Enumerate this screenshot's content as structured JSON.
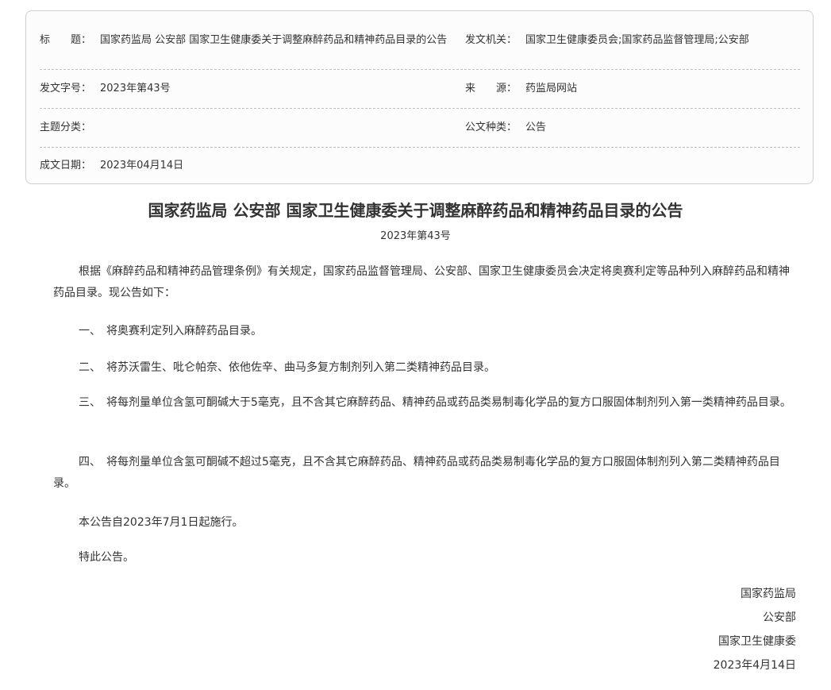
{
  "info": {
    "title_label": "标　　题：",
    "title_value": "国家药监局 公安部 国家卫生健康委关于调整麻醉药品和精神药品目录的公告",
    "issuer_label": "发文机关：",
    "issuer_value": "国家卫生健康委员会;国家药品监督管理局;公安部",
    "doc_no_label": "发文字号：",
    "doc_no_value": "2023年第43号",
    "source_label": "来　　源：",
    "source_value": "药监局网站",
    "topic_label": "主题分类：",
    "topic_value": "",
    "type_label": "公文种类：",
    "type_value": "公告",
    "date_label": "成文日期：",
    "date_value": "2023年04月14日"
  },
  "doc": {
    "title": "国家药监局 公安部 国家卫生健康委关于调整麻醉药品和精神药品目录的公告",
    "number": "2023年第43号",
    "paragraphs": [
      "根据《麻醉药品和精神药品管理条例》有关规定，国家药品监督管理局、公安部、国家卫生健康委员会决定将奥赛利定等品种列入麻醉药品和精神药品目录。现公告如下：",
      "一、　将奥赛利定列入麻醉药品目录。",
      "二、　将苏沃雷生、吡仑帕奈、依他佐辛、曲马多复方制剂列入第二类精神药品目录。",
      "三、　将每剂量单位含氢可酮碱大于5毫克，且不含其它麻醉药品、精神药品或药品类易制毒化学品的复方口服固体制剂列入第一类精神药品目录。",
      "四、　将每剂量单位含氢可酮碱不超过5毫克，且不含其它麻醉药品、精神药品或药品类易制毒化学品的复方口服固体制剂列入第二类精神药品目录。",
      "本公告自2023年7月1日起施行。",
      "特此公告。"
    ],
    "signatures": [
      "国家药监局",
      "公安部",
      "国家卫生健康委",
      "2023年4月14日"
    ]
  }
}
